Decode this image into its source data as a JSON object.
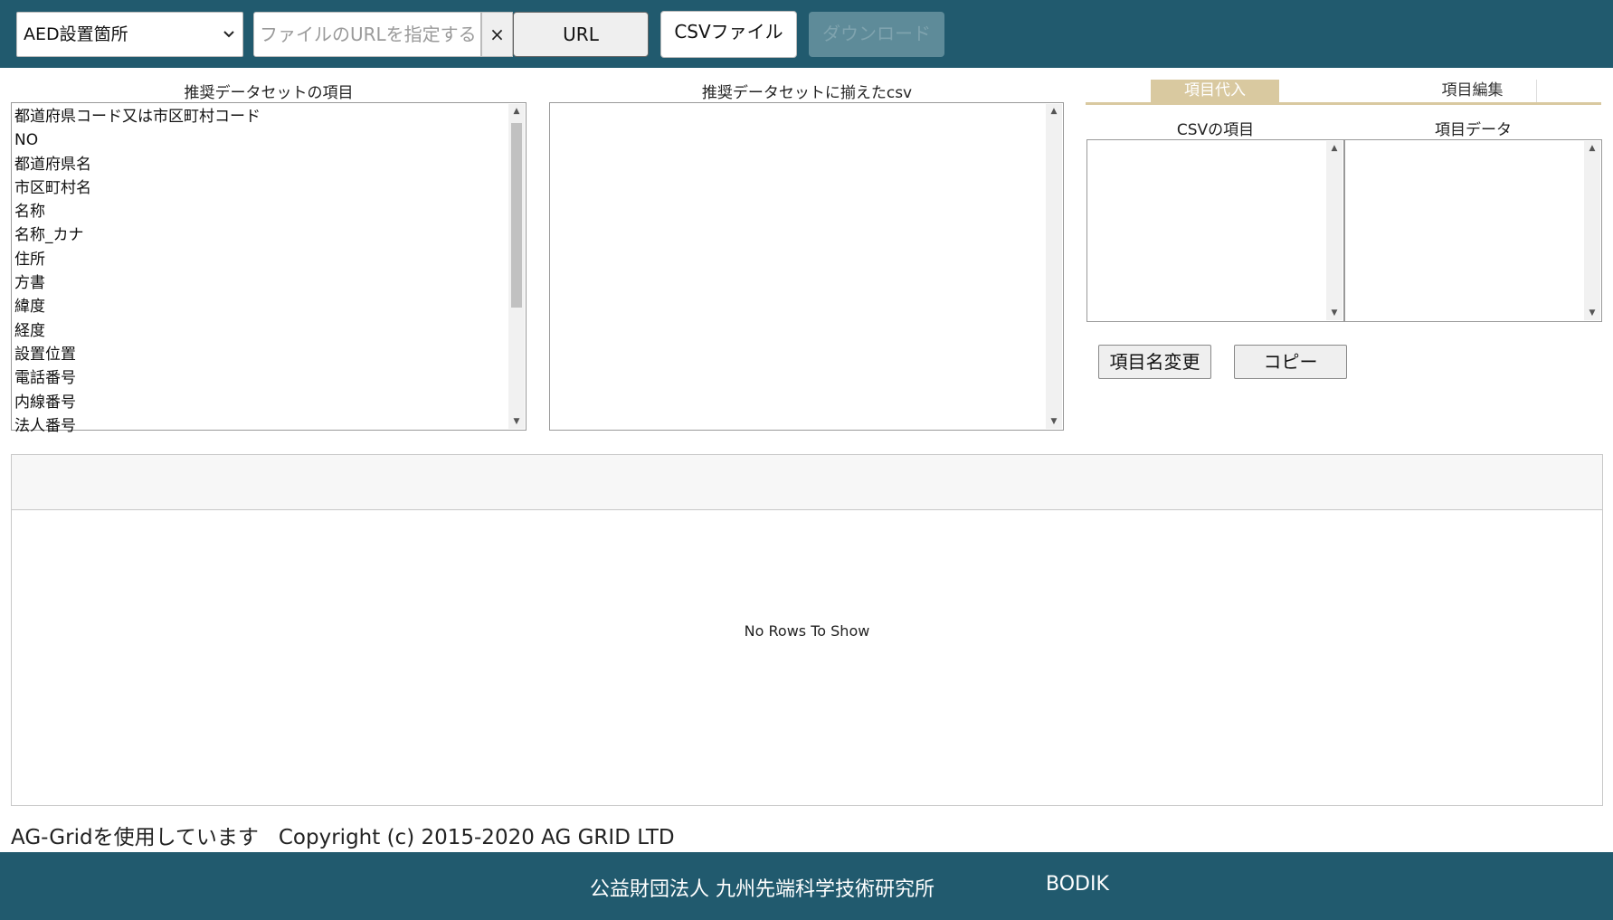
{
  "toolbar": {
    "dataset_select": "AED設置箇所",
    "url_placeholder": "ファイルのURLを指定する",
    "clear_label": "×",
    "url_button": "URL",
    "csv_button": "CSVファイル",
    "download_button": "ダウンロード"
  },
  "recommended": {
    "title": "推奨データセットの項目",
    "items": [
      "都道府県コード又は市区町村コード",
      "NO",
      "都道府県名",
      "市区町村名",
      "名称",
      "名称_カナ",
      "住所",
      "方書",
      "緯度",
      "経度",
      "設置位置",
      "電話番号",
      "内線番号",
      "法人番号"
    ]
  },
  "aligned_csv": {
    "title": "推奨データセットに揃えたcsv"
  },
  "tabs": {
    "assign": "項目代入",
    "edit": "項目編集"
  },
  "mapping": {
    "csv_items_label": "CSVの項目",
    "item_data_label": "項目データ",
    "rename_button": "項目名変更",
    "copy_button": "コピー"
  },
  "grid": {
    "empty_message": "No Rows To Show"
  },
  "credits": {
    "agrid_note": "AG-Gridを使用しています",
    "copyright": "Copyright (c) 2015-2020 AG GRID LTD"
  },
  "footer": {
    "organization": "公益財団法人 九州先端科学技術研究所",
    "brand": "BODIK"
  },
  "colors": {
    "header_bg": "#215a6e",
    "tab_active": "#d9c9a0",
    "download_disabled": "#5e8b99"
  }
}
